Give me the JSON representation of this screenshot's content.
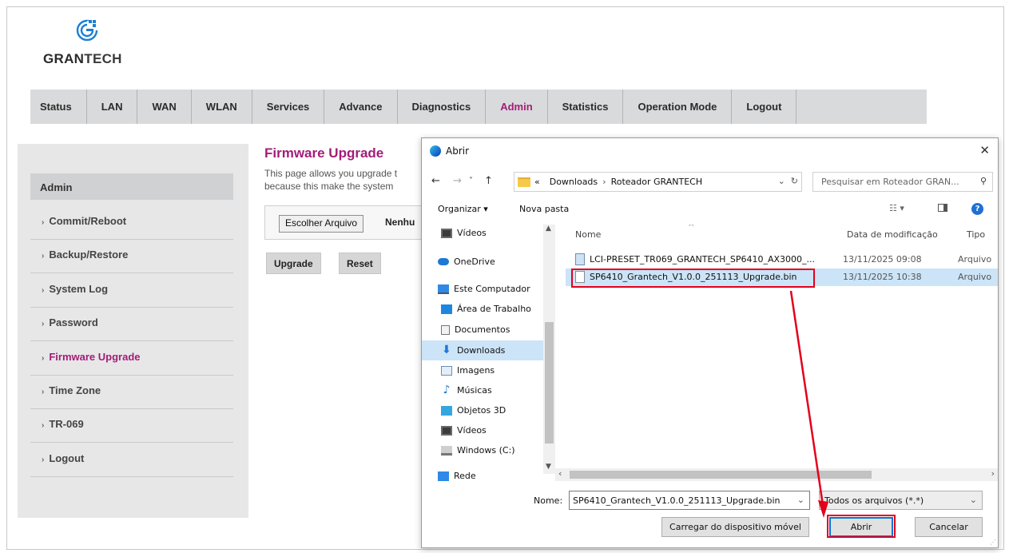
{
  "router": {
    "brand": {
      "prefix": "GRAN",
      "suffix": "TECH"
    },
    "nav": [
      "Status",
      "LAN",
      "WAN",
      "WLAN",
      "Services",
      "Advance",
      "Diagnostics",
      "Admin",
      "Statistics",
      "Operation Mode",
      "Logout"
    ],
    "nav_active": "Admin",
    "sidebar": {
      "heading": "Admin",
      "items": [
        "Commit/Reboot",
        "Backup/Restore",
        "System Log",
        "Password",
        "Firmware Upgrade",
        "Time Zone",
        "TR-069",
        "Logout"
      ],
      "active": "Firmware Upgrade"
    },
    "firmware": {
      "title": "Firmware Upgrade",
      "desc_line1": "This page allows you upgrade t",
      "desc_line2": "because this make the system",
      "choose_file": "Escolher Arquivo",
      "no_file": "Nenhu",
      "upgrade": "Upgrade",
      "reset": "Reset"
    },
    "colors": {
      "accent": "#a31c78",
      "navbar": "#d9dadb",
      "sidebar": "#e7e7e8"
    }
  },
  "dialog": {
    "title": "Abrir",
    "close": "✕",
    "nav_buttons": {
      "back": "←",
      "forward": "→",
      "recent": "˅",
      "up": "↑"
    },
    "path": {
      "prefix": "«",
      "items": [
        "Downloads",
        "Roteador GRANTECH"
      ]
    },
    "search_placeholder": "Pesquisar em Roteador GRAN...",
    "toolbar": {
      "organize": "Organizar ▾",
      "new_folder": "Nova pasta"
    },
    "nav_pane": [
      {
        "label": "Vídeos",
        "icon": "video-icon"
      },
      {
        "label": "OneDrive",
        "icon": "cloud-icon"
      },
      {
        "label": "Este Computador",
        "icon": "computer-icon"
      },
      {
        "label": "Área de Trabalho",
        "icon": "desktop-icon"
      },
      {
        "label": "Documentos",
        "icon": "document-icon"
      },
      {
        "label": "Downloads",
        "icon": "download-icon"
      },
      {
        "label": "Imagens",
        "icon": "image-icon"
      },
      {
        "label": "Músicas",
        "icon": "music-icon"
      },
      {
        "label": "Objetos 3D",
        "icon": "cube-icon"
      },
      {
        "label": "Vídeos",
        "icon": "video-icon"
      },
      {
        "label": "Windows (C:)",
        "icon": "drive-icon"
      },
      {
        "label": "Rede",
        "icon": "network-icon"
      }
    ],
    "nav_selected": "Downloads",
    "columns": {
      "name": "Nome",
      "date": "Data de modificação",
      "type": "Tipo"
    },
    "files": [
      {
        "name": "LCI-PRESET_TR069_GRANTECH_SP6410_AX3000_...",
        "date": "13/11/2025 09:08",
        "type": "Arquivo"
      },
      {
        "name": "SP6410_Grantech_V1.0.0_251113_Upgrade.bin",
        "date": "13/11/2025 10:38",
        "type": "Arquivo"
      }
    ],
    "selected_file": "SP6410_Grantech_V1.0.0_251113_Upgrade.bin",
    "name_label": "Nome:",
    "name_value": "SP6410_Grantech_V1.0.0_251113_Upgrade.bin",
    "file_type": "Todos os arquivos (*.*)",
    "buttons": {
      "mobile": "Carregar do dispositivo móvel",
      "open": "Abrir",
      "cancel": "Cancelar"
    },
    "colors": {
      "highlight": "#e3001b",
      "selection": "#cce4f7"
    }
  }
}
